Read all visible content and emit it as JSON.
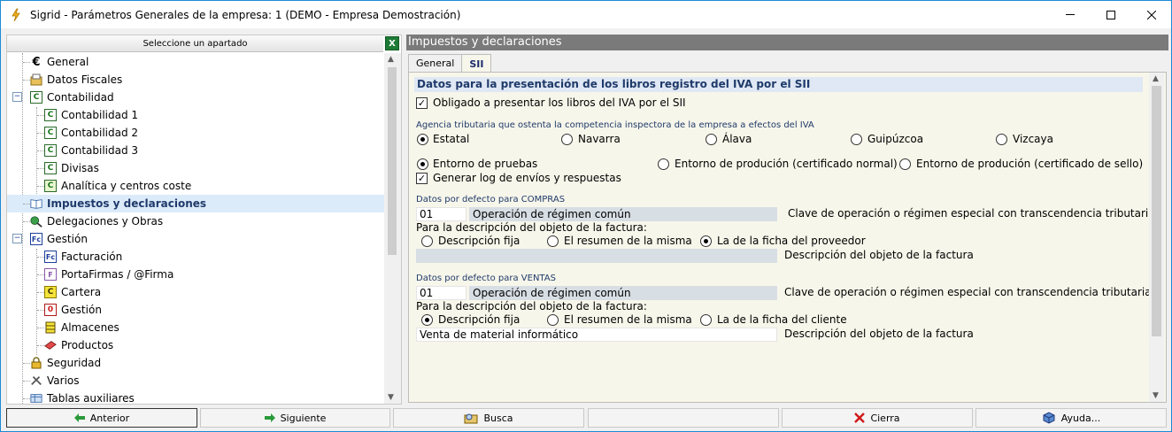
{
  "window": {
    "title": "Sigrid - Parámetros Generales de la empresa: 1 (DEMO - Empresa Demostración)"
  },
  "left_panel": {
    "header": "Seleccione un apartado",
    "items": [
      {
        "label": "General",
        "icon": "euro-icon"
      },
      {
        "label": "Datos Fiscales",
        "icon": "fiscal-icon"
      },
      {
        "label": "Contabilidad",
        "icon": "c-green-icon"
      },
      {
        "label": "Contabilidad 1",
        "icon": "c-green-icon"
      },
      {
        "label": "Contabilidad 2",
        "icon": "c-green-icon"
      },
      {
        "label": "Contabilidad 3",
        "icon": "c-green-icon"
      },
      {
        "label": "Divisas",
        "icon": "c-green-icon"
      },
      {
        "label": "Analítica y centros coste",
        "icon": "c-green-icon"
      },
      {
        "label": "Impuestos y declaraciones",
        "icon": "book-icon"
      },
      {
        "label": "Delegaciones y Obras",
        "icon": "delegations-icon"
      },
      {
        "label": "Gestión",
        "icon": "fc-blue-icon"
      },
      {
        "label": "Facturación",
        "icon": "fc-blue-icon"
      },
      {
        "label": "PortaFirmas / @Firma",
        "icon": "portafirmas-icon"
      },
      {
        "label": "Cartera",
        "icon": "c-yellow-icon"
      },
      {
        "label": "Gestión",
        "icon": "zero-red-icon"
      },
      {
        "label": "Almacenes",
        "icon": "warehouse-icon"
      },
      {
        "label": "Productos",
        "icon": "eraser-icon"
      },
      {
        "label": "Seguridad",
        "icon": "lock-icon"
      },
      {
        "label": "Varios",
        "icon": "tools-icon"
      },
      {
        "label": "Tablas auxiliares",
        "icon": "tables-icon"
      }
    ]
  },
  "right_panel": {
    "header": "Impuestos y declaraciones",
    "tabs": [
      {
        "label": "General"
      },
      {
        "label": "SII"
      }
    ],
    "section_title": "Datos para la presentación de los libros registro del IVA por el SII",
    "obligado_label": "Obligado a presentar los libros del IVA por el SII",
    "obligado_checked": true,
    "agencia_label": "Agencia tributaria que ostenta la competencia inspectora de la empresa a efectos del IVA",
    "agencias": [
      "Estatal",
      "Navarra",
      "Álava",
      "Guipúzcoa",
      "Vizcaya"
    ],
    "agencia_selected": "Estatal",
    "entornos": [
      "Entorno de pruebas",
      "Entorno de produción (certificado normal)",
      "Entorno de produción (certificado de sello)"
    ],
    "entorno_selected": "Entorno de pruebas",
    "log_label": "Generar log de envíos y respuestas",
    "log_checked": true,
    "compras": {
      "title": "Datos por defecto para COMPRAS",
      "code": "01",
      "code_desc": "Operación de régimen común",
      "clave_label": "Clave de operación o régimen especial con transcendencia tributaria",
      "desc_label": "Para la descripción del objeto de la factura:",
      "options": [
        "Descripción fija",
        "El resumen de la misma",
        "La de la ficha del proveedor"
      ],
      "selected": "La de la ficha del proveedor",
      "desc_value": "",
      "desc_field_label": "Descripción del objeto de la factura"
    },
    "ventas": {
      "title": "Datos por defecto para VENTAS",
      "code": "01",
      "code_desc": "Operación de régimen común",
      "clave_label": "Clave de operación o régimen especial con transcendencia tributaria",
      "desc_label": "Para la descripción del objeto de la factura:",
      "options": [
        "Descripción fija",
        "El resumen de la misma",
        "La de la ficha del cliente"
      ],
      "selected": "Descripción fija",
      "desc_value": "Venta de material informático",
      "desc_field_label": "Descripción del objeto de la factura"
    }
  },
  "toolbar": {
    "anterior": "Anterior",
    "siguiente": "Siguiente",
    "busca": "Busca",
    "blank": "",
    "cierra": "Cierra",
    "ayuda": "Ayuda..."
  }
}
